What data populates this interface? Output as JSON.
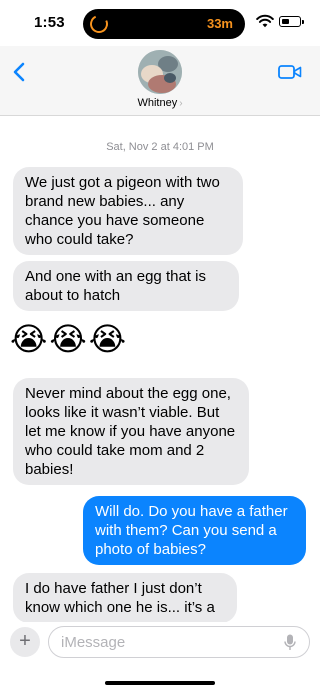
{
  "status_bar": {
    "time": "1:53",
    "timer": "33m"
  },
  "header": {
    "contact_name": "Whitney",
    "chevron": "›"
  },
  "conversation": {
    "timestamp_day": "Sat, Nov 2",
    "timestamp_time": "at 4:01 PM",
    "messages": [
      {
        "direction": "incoming",
        "text": "We just got a pigeon with two brand new babies... any chance you have someone who could take?"
      },
      {
        "direction": "incoming",
        "text": "And one with an egg that is about to hatch"
      },
      {
        "direction": "incoming",
        "text": "😭😭😭"
      },
      {
        "direction": "incoming",
        "text": "Never mind about the egg one, looks like it wasn’t viable. But let me know if you have anyone who could take mom and 2 babies!"
      },
      {
        "direction": "outgoing",
        "text": "Will do. Do you have a father with them? Can you send a photo of babies?"
      },
      {
        "direction": "incoming",
        "text": "I do have father I just don’t know which one he is... it’s a"
      }
    ]
  },
  "input": {
    "placeholder": "iMessage",
    "plus_label": "+"
  },
  "colors": {
    "incoming_bubble": "#e9e9eb",
    "outgoing_bubble": "#0b84fe",
    "accent": "#0b84fe",
    "timer": "#f7931e"
  },
  "icons": [
    "back-chevron-icon",
    "video-camera-icon",
    "wifi-icon",
    "battery-icon",
    "timer-icon",
    "plus-icon",
    "microphone-icon"
  ]
}
